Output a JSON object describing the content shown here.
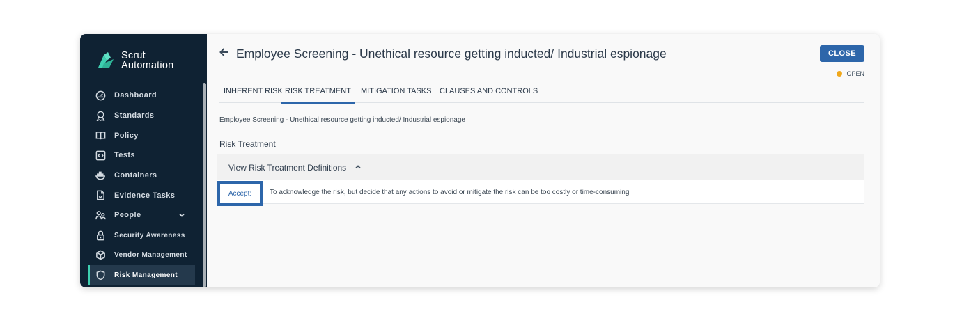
{
  "brand": {
    "line1": "Scrut",
    "line2": "Automation"
  },
  "sidebar": {
    "items": [
      {
        "label": "Dashboard",
        "icon": "dashboard-icon"
      },
      {
        "label": "Standards",
        "icon": "award-icon"
      },
      {
        "label": "Policy",
        "icon": "book-icon"
      },
      {
        "label": "Tests",
        "icon": "code-icon"
      },
      {
        "label": "Containers",
        "icon": "docker-icon"
      },
      {
        "label": "Evidence Tasks",
        "icon": "file-check-icon"
      },
      {
        "label": "People",
        "icon": "people-icon"
      },
      {
        "label": "Security Awareness",
        "icon": "lock-icon"
      },
      {
        "label": "Vendor Management",
        "icon": "box-icon"
      },
      {
        "label": "Risk Management",
        "icon": "shield-icon"
      }
    ],
    "active": "Risk Management"
  },
  "header": {
    "title": "Employee Screening - Unethical resource getting inducted/ Industrial espionage",
    "close_label": "CLOSE",
    "status": "OPEN",
    "status_color": "#f0a81c"
  },
  "tabs": [
    "INHERENT RISK",
    "RISK TREATMENT",
    "MITIGATION TASKS",
    "CLAUSES AND CONTROLS"
  ],
  "active_tab": "RISK TREATMENT",
  "content": {
    "description": "Employee Screening - Unethical resource getting inducted/ Industrial espionage",
    "section_label": "Risk Treatment",
    "panel_title": "View Risk Treatment Definitions",
    "definition_key": "Accept:",
    "definition_text": "To acknowledge the risk, but decide that any actions to avoid or mitigate the risk can be too costly or time-consuming"
  },
  "colors": {
    "sidebar": "#0f2233",
    "accent": "#2d66aa",
    "active_indicator": "#3ecfb0"
  }
}
